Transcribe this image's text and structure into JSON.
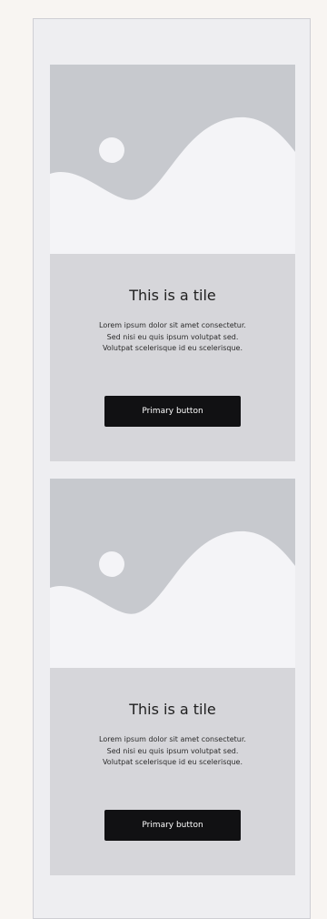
{
  "tiles": [
    {
      "title": "This is a tile",
      "description_lines": [
        "Lorem ipsum dolor sit amet consectetur.",
        "Sed nisi eu quis ipsum volutpat sed.",
        "Volutpat scelerisque id eu scelerisque."
      ],
      "button_label": "Primary button",
      "image_icon": "landscape-placeholder-icon"
    },
    {
      "title": "This is a tile",
      "description_lines": [
        "Lorem ipsum dolor sit amet consectetur.",
        "Sed nisi eu quis ipsum volutpat sed.",
        "Volutpat scelerisque id eu scelerisque."
      ],
      "button_label": "Primary button",
      "image_icon": "landscape-placeholder-icon"
    }
  ],
  "colors": {
    "page_bg": "#f8f5f2",
    "frame_bg": "#eeeef1",
    "tile_bg": "#d6d6da",
    "image_placeholder": "#c7c9ce",
    "button_bg": "#111113",
    "button_text": "#ffffff"
  }
}
